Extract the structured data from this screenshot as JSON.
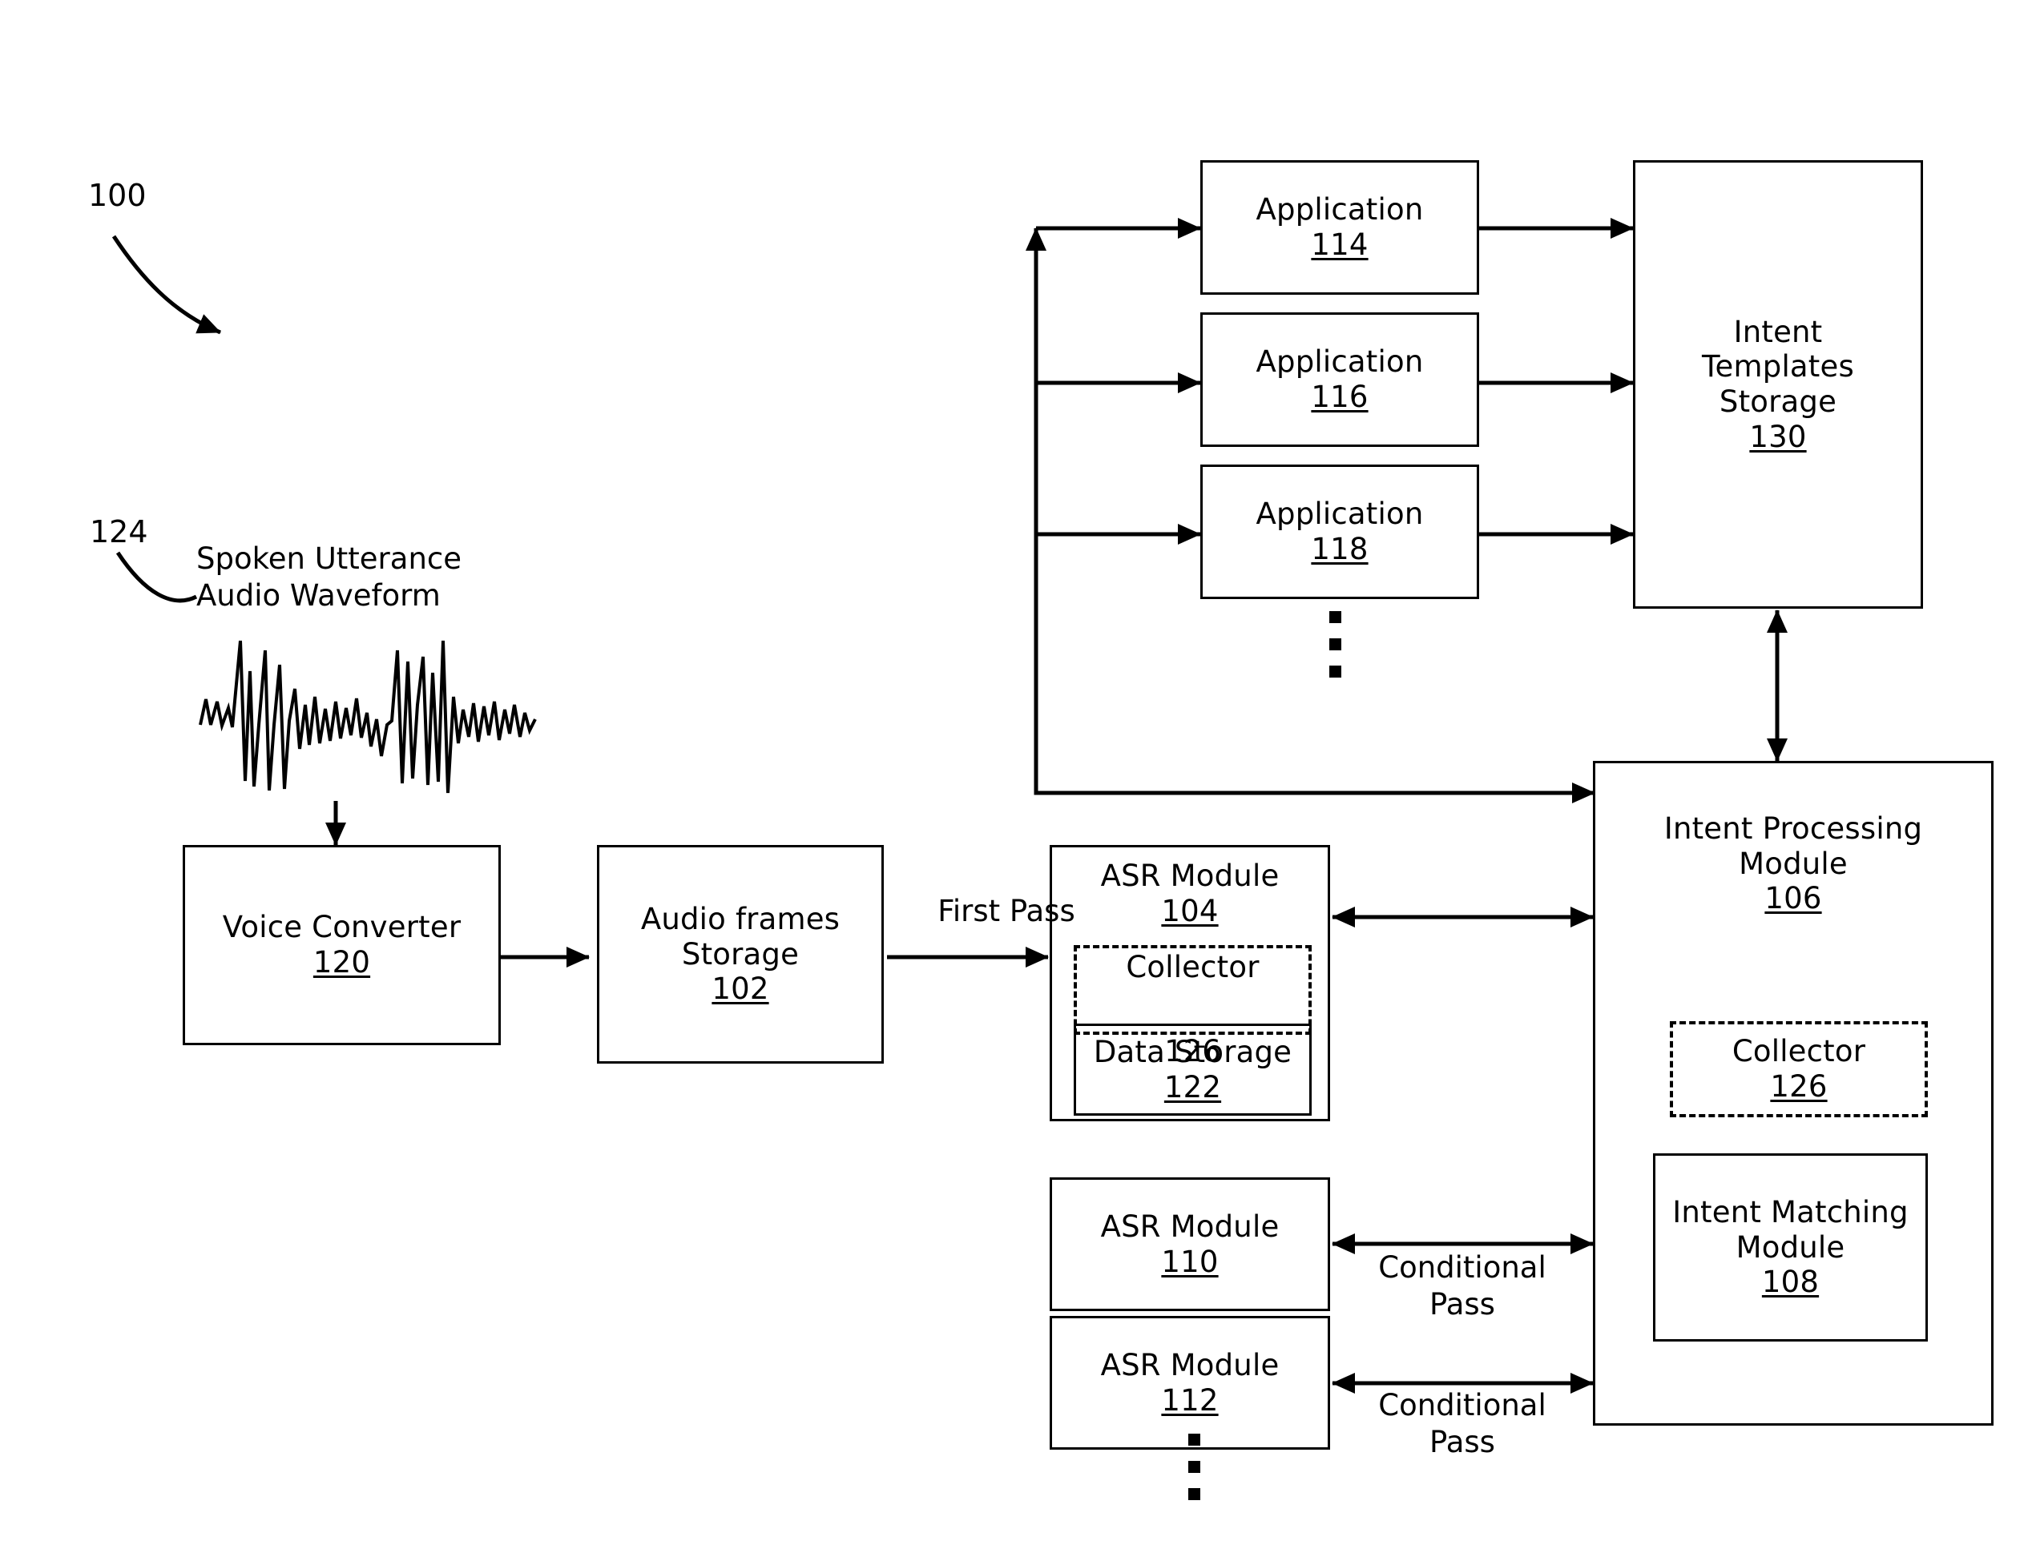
{
  "figure": {
    "reference_numeral": "100",
    "utterance_numeral": "124",
    "utterance_label": "Spoken Utterance\nAudio Waveform"
  },
  "edge_labels": {
    "first_pass": "First Pass",
    "conditional_pass_1": "Conditional\nPass",
    "conditional_pass_2": "Conditional\nPass"
  },
  "blocks": {
    "voice_converter": {
      "title": "Voice Converter",
      "num": "120"
    },
    "audio_frames_storage": {
      "title": "Audio frames\nStorage",
      "num": "102"
    },
    "asr_module_104": {
      "title": "ASR Module",
      "num": "104"
    },
    "collector_asr": {
      "title": "Collector",
      "num": "126"
    },
    "data_storage_122": {
      "title": "Data Storage",
      "num": "122"
    },
    "asr_module_110": {
      "title": "ASR Module",
      "num": "110"
    },
    "asr_module_112": {
      "title": "ASR Module",
      "num": "112"
    },
    "application_114": {
      "title": "Application",
      "num": "114"
    },
    "application_116": {
      "title": "Application",
      "num": "116"
    },
    "application_118": {
      "title": "Application",
      "num": "118"
    },
    "intent_templates_storage": {
      "title": "Intent\nTemplates\nStorage",
      "num": "130"
    },
    "intent_processing_module": {
      "title": "Intent Processing\nModule",
      "num": "106"
    },
    "collector_ipm": {
      "title": "Collector",
      "num": "126"
    },
    "intent_matching_module": {
      "title": "Intent Matching\nModule",
      "num": "108"
    }
  },
  "colors": {
    "stroke": "#000000",
    "background": "#ffffff"
  }
}
